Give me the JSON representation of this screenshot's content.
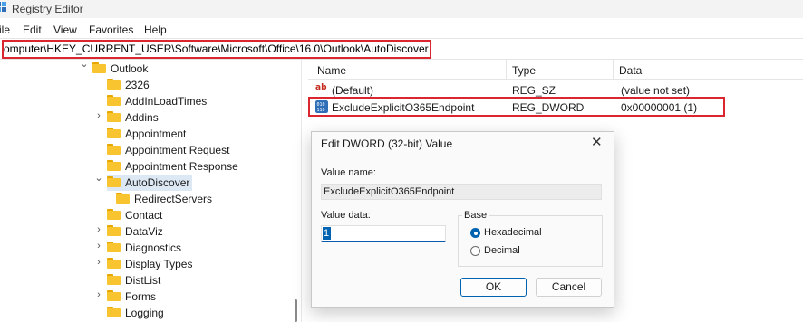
{
  "app": {
    "title": "Registry Editor"
  },
  "menu": [
    "ile",
    "Edit",
    "View",
    "Favorites",
    "Help"
  ],
  "address": "omputer\\HKEY_CURRENT_USER\\Software\\Microsoft\\Office\\16.0\\Outlook\\AutoDiscover",
  "tree": [
    {
      "label": "Outlook",
      "chevron": "down"
    },
    {
      "label": "2326",
      "chevron": ""
    },
    {
      "label": "AddInLoadTimes",
      "chevron": ""
    },
    {
      "label": "Addins",
      "chevron": "right"
    },
    {
      "label": "Appointment",
      "chevron": ""
    },
    {
      "label": "Appointment Request",
      "chevron": ""
    },
    {
      "label": "Appointment Response",
      "chevron": ""
    },
    {
      "label": "AutoDiscover",
      "chevron": "down",
      "selected": true
    },
    {
      "label": "RedirectServers",
      "chevron": ""
    },
    {
      "label": "Contact",
      "chevron": ""
    },
    {
      "label": "DataViz",
      "chevron": "right"
    },
    {
      "label": "Diagnostics",
      "chevron": "right"
    },
    {
      "label": "Display Types",
      "chevron": "right"
    },
    {
      "label": "DistList",
      "chevron": ""
    },
    {
      "label": "Forms",
      "chevron": "right"
    },
    {
      "label": "Logging",
      "chevron": ""
    }
  ],
  "list": {
    "columns": [
      "Name",
      "Type",
      "Data"
    ],
    "rows": [
      {
        "icon": "string-value-icon",
        "name": "(Default)",
        "type": "REG_SZ",
        "data": "(value not set)"
      },
      {
        "icon": "binary-value-icon",
        "name": "ExcludeExplicitO365Endpoint",
        "type": "REG_DWORD",
        "data": "0x00000001 (1)"
      }
    ]
  },
  "dialog": {
    "title": "Edit DWORD (32-bit) Value",
    "value_name_label": "Value name:",
    "value_name": "ExcludeExplicitO365Endpoint",
    "value_data_label": "Value data:",
    "value_data": "1",
    "base_label": "Base",
    "base_options": [
      "Hexadecimal",
      "Decimal"
    ],
    "base_selected": "Hexadecimal",
    "ok_label": "OK",
    "cancel_label": "Cancel"
  },
  "colors": {
    "highlight": "#d9262f",
    "accent": "#0063b1",
    "folder": "#f8c531"
  }
}
